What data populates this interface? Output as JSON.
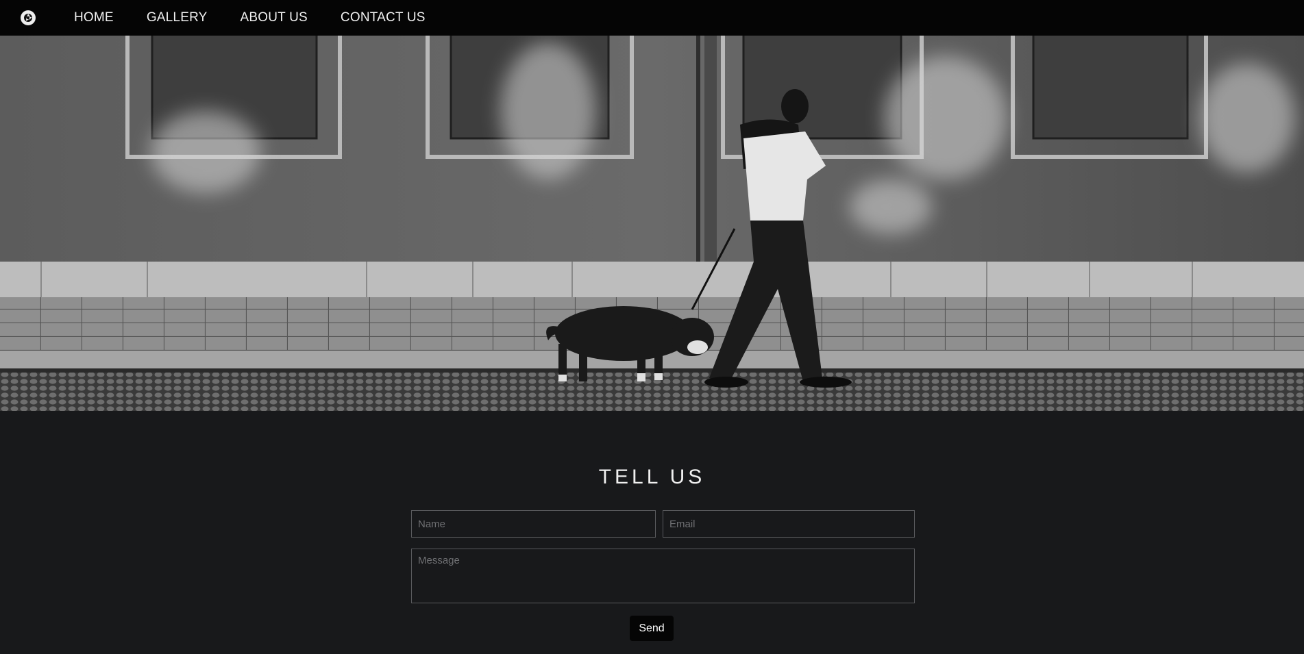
{
  "nav": {
    "logo_icon": "aperture-icon",
    "links": [
      "HOME",
      "GALLERY",
      "ABOUT US",
      "CONTACT US"
    ]
  },
  "hero": {
    "image": "black-and-white street photo of a man on the phone walking a dog along a wall"
  },
  "contact": {
    "title": "TELL US",
    "name_placeholder": "Name",
    "email_placeholder": "Email",
    "message_placeholder": "Message",
    "send_label": "Send"
  },
  "colors": {
    "navbar": "#050505",
    "background": "#18191b",
    "field_border": "#5a5b5e",
    "button": "#050505"
  }
}
